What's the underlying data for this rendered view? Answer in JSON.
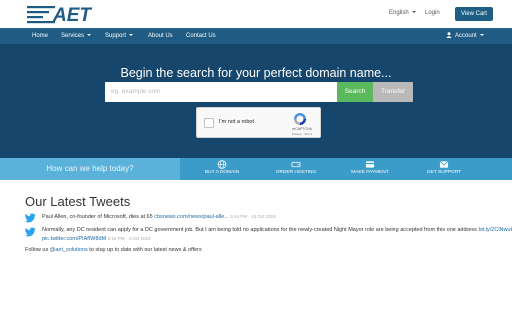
{
  "header": {
    "logo_text": "AET",
    "language": "English",
    "login": "Login",
    "view_cart": "View Cart"
  },
  "nav": {
    "home": "Home",
    "services": "Services",
    "support": "Support",
    "about": "About Us",
    "contact": "Contact Us",
    "account": "Account"
  },
  "hero": {
    "title": "Begin the search for your perfect domain name...",
    "domain_placeholder": "eg. example.com",
    "search": "Search",
    "transfer": "Transfer"
  },
  "recaptcha": {
    "label": "I'm not a robot",
    "brand": "reCAPTCHA",
    "links": "Privacy - Terms"
  },
  "help": {
    "label": "How can we help today?",
    "items": [
      {
        "label": "BUY A DOMAIN",
        "icon": "globe-icon"
      },
      {
        "label": "ORDER HOSTING",
        "icon": "server-icon"
      },
      {
        "label": "MAKE PAYMENT",
        "icon": "credit-card-icon"
      },
      {
        "label": "GET SUPPORT",
        "icon": "envelope-icon"
      }
    ]
  },
  "tweets": {
    "title": "Our Latest Tweets",
    "items": [
      {
        "text": "Paul Allen, co-founder of Microsoft, dies at 65",
        "link": "cbsnews.com/news/paul-alle...",
        "date": "5:44 PM - 15 Oct 2018"
      },
      {
        "text": "Normally, any DC resident can apply for a DC government job. But I am being told no applications for the newly-created Night Mayor role are being accepted from this one address",
        "link": "bit.ly/2CiNwuH pic.twitter.com/PIAfIW8dM",
        "date": "5:16 PM - 4 Oct 2018"
      }
    ],
    "follow_prefix": "Follow us",
    "follow_handle": "@aet_solutions",
    "follow_suffix": "to stay up to date with our latest news & offers"
  },
  "colors": {
    "nav": "#1f5b82",
    "hero": "#16466b",
    "help_strip": "#3c9cc9",
    "search_button": "#5cb85c",
    "transfer_button": "#b9b9b9",
    "link": "#1f6aa5"
  }
}
